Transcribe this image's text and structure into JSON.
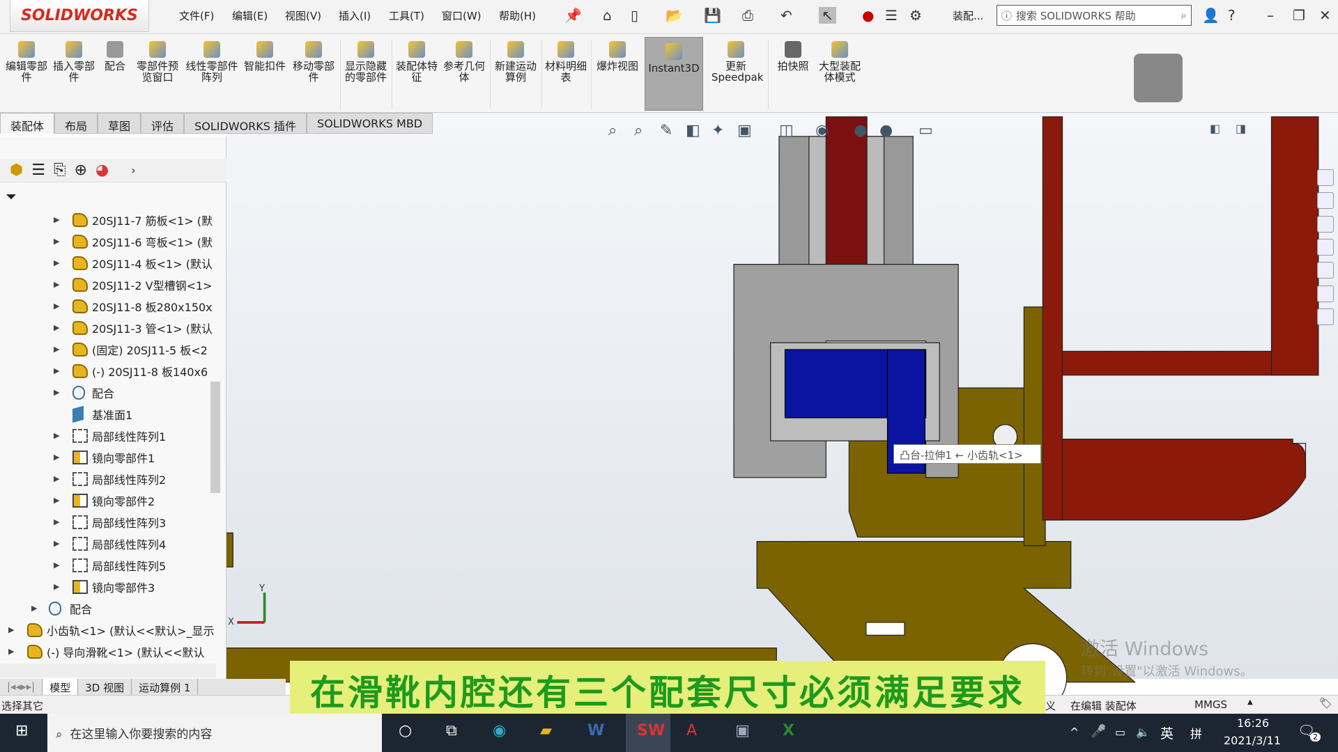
{
  "app": {
    "logo": "SOLIDWORKS",
    "menu": [
      "文件(F)",
      "编辑(E)",
      "视图(V)",
      "插入(I)",
      "工具(T)",
      "窗口(W)",
      "帮助(H)"
    ],
    "doc_short": "装配...",
    "search_placeholder": "搜索 SOLIDWORKS 帮助"
  },
  "ribbon": {
    "items": [
      "编辑零部件",
      "插入零部件",
      "配合",
      "零部件预览窗口",
      "线性零部件阵列",
      "智能扣件",
      "移动零部件",
      "显示隐藏的零部件",
      "装配体特征",
      "参考几何体",
      "新建运动算例",
      "材料明细表",
      "爆炸视图",
      "Instant3D",
      "更新Speedpak",
      "拍快照",
      "大型装配体模式"
    ],
    "active": "Instant3D"
  },
  "tabs": [
    "装配体",
    "布局",
    "草图",
    "评估",
    "SOLIDWORKS 插件",
    "SOLIDWORKS MBD"
  ],
  "tree": [
    {
      "level": 2,
      "icon": "part",
      "label": "20SJ11-7 筋板<1> (默"
    },
    {
      "level": 2,
      "icon": "part",
      "label": "20SJ11-6 弯板<1> (默"
    },
    {
      "level": 2,
      "icon": "part",
      "label": "20SJ11-4 板<1> (默认"
    },
    {
      "level": 2,
      "icon": "part",
      "label": "20SJ11-2 V型槽钢<1>"
    },
    {
      "level": 2,
      "icon": "part",
      "label": "20SJ11-8 板280x150x"
    },
    {
      "level": 2,
      "icon": "part",
      "label": "20SJ11-3 管<1> (默认"
    },
    {
      "level": 2,
      "icon": "part",
      "label": "(固定) 20SJ11-5 板<2"
    },
    {
      "level": 2,
      "icon": "part",
      "label": "(-) 20SJ11-8 板140x6"
    },
    {
      "level": 2,
      "icon": "mate",
      "label": "配合"
    },
    {
      "level": 2,
      "icon": "plane",
      "label": "基准面1",
      "noexp": true
    },
    {
      "level": 2,
      "icon": "pattern",
      "label": "局部线性阵列1"
    },
    {
      "level": 2,
      "icon": "mirror",
      "label": "镜向零部件1"
    },
    {
      "level": 2,
      "icon": "pattern",
      "label": "局部线性阵列2"
    },
    {
      "level": 2,
      "icon": "mirror",
      "label": "镜向零部件2"
    },
    {
      "level": 2,
      "icon": "pattern",
      "label": "局部线性阵列3"
    },
    {
      "level": 2,
      "icon": "pattern",
      "label": "局部线性阵列4"
    },
    {
      "level": 2,
      "icon": "pattern",
      "label": "局部线性阵列5"
    },
    {
      "level": 2,
      "icon": "mirror",
      "label": "镜向零部件3"
    },
    {
      "level": 1,
      "icon": "mate",
      "label": "配合"
    },
    {
      "level": 0,
      "icon": "part",
      "label": "小齿轨<1> (默认<<默认>_显示"
    },
    {
      "level": 0,
      "icon": "part",
      "label": "(-) 导向滑靴<1> (默认<<默认"
    }
  ],
  "bottom_tabs": [
    "模型",
    "3D 视图",
    "运动算例 1"
  ],
  "status": {
    "left": "选择其它",
    "editing": "在编辑 装配体",
    "units": "MMGS",
    "partial": "义"
  },
  "tooltip": "凸台-拉伸1 ← 小齿轨<1>",
  "triad": {
    "x": "X",
    "y": "Y"
  },
  "subtitle": "在滑靴内腔还有三个配套尺寸必须满足要求",
  "watermark": {
    "line1": "激活 Windows",
    "line2": "转到\"设置\"以激活 Windows。"
  },
  "taskbar": {
    "search_placeholder": "在这里输入你要搜索的内容",
    "time": "16:26",
    "date": "2021/3/11",
    "ime_lang": "英",
    "ime_mode": "拼",
    "notifications": "2"
  },
  "colors": {
    "subtitle_bg": "#e6ef7a",
    "subtitle_text": "#1e9a1e",
    "brand": "#d52b1e",
    "olive": "#7a6300",
    "red_frame": "#8b1a0a",
    "blue_part": "#0a14a0"
  }
}
